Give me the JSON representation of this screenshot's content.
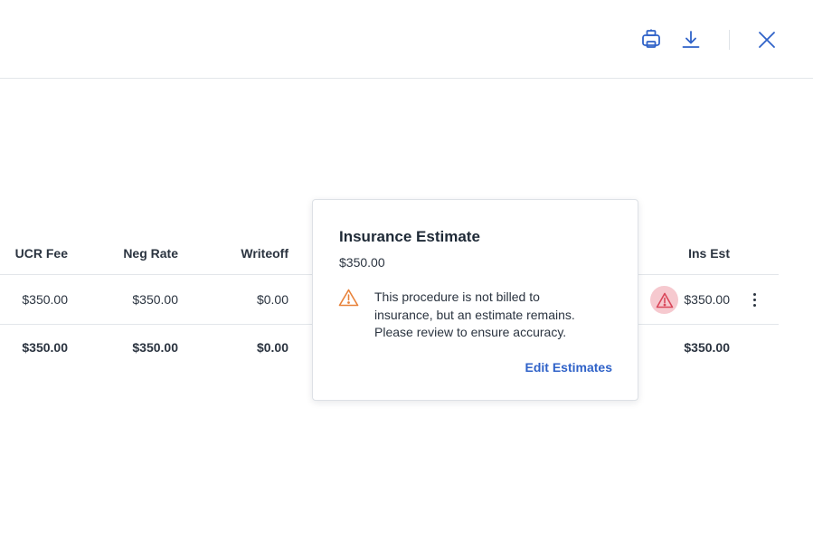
{
  "toolbar": {
    "print_icon": "printer-icon",
    "download_icon": "download-icon",
    "close_icon": "close-icon"
  },
  "table": {
    "headers": [
      "UCR Fee",
      "Neg Rate",
      "Writeoff",
      "Ins Est"
    ],
    "row": {
      "ucr_fee": "$350.00",
      "neg_rate": "$350.00",
      "writeoff": "$0.00",
      "ins_est": "$350.00",
      "status_icon": "warning-icon"
    },
    "totals": {
      "ucr_fee": "$350.00",
      "neg_rate": "$350.00",
      "writeoff": "$0.00",
      "ins_est": "$350.00"
    }
  },
  "popover": {
    "title": "Insurance Estimate",
    "amount": "$350.00",
    "message_lines": [
      "This procedure is not billed to",
      "insurance, but an estimate remains.",
      "Please review to ensure accuracy."
    ],
    "link_label": "Edit Estimates"
  },
  "colors": {
    "accent": "#2f62c8",
    "warning_orange": "#e8823a",
    "warning_red": "#d9475a",
    "warning_bubble": "#f6c9cf",
    "divider": "#e3e6ea"
  }
}
